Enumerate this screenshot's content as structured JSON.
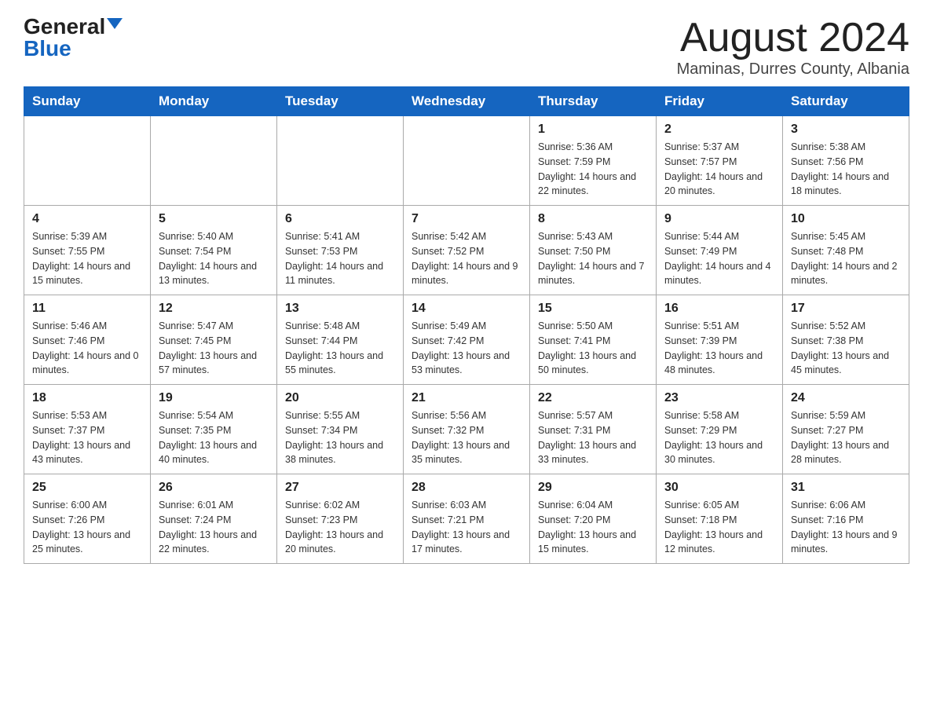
{
  "logo": {
    "text_general": "General",
    "text_blue": "Blue"
  },
  "title": "August 2024",
  "subtitle": "Maminas, Durres County, Albania",
  "days_of_week": [
    "Sunday",
    "Monday",
    "Tuesday",
    "Wednesday",
    "Thursday",
    "Friday",
    "Saturday"
  ],
  "weeks": [
    [
      null,
      null,
      null,
      null,
      {
        "num": "1",
        "sunrise": "Sunrise: 5:36 AM",
        "sunset": "Sunset: 7:59 PM",
        "daylight": "Daylight: 14 hours and 22 minutes."
      },
      {
        "num": "2",
        "sunrise": "Sunrise: 5:37 AM",
        "sunset": "Sunset: 7:57 PM",
        "daylight": "Daylight: 14 hours and 20 minutes."
      },
      {
        "num": "3",
        "sunrise": "Sunrise: 5:38 AM",
        "sunset": "Sunset: 7:56 PM",
        "daylight": "Daylight: 14 hours and 18 minutes."
      }
    ],
    [
      {
        "num": "4",
        "sunrise": "Sunrise: 5:39 AM",
        "sunset": "Sunset: 7:55 PM",
        "daylight": "Daylight: 14 hours and 15 minutes."
      },
      {
        "num": "5",
        "sunrise": "Sunrise: 5:40 AM",
        "sunset": "Sunset: 7:54 PM",
        "daylight": "Daylight: 14 hours and 13 minutes."
      },
      {
        "num": "6",
        "sunrise": "Sunrise: 5:41 AM",
        "sunset": "Sunset: 7:53 PM",
        "daylight": "Daylight: 14 hours and 11 minutes."
      },
      {
        "num": "7",
        "sunrise": "Sunrise: 5:42 AM",
        "sunset": "Sunset: 7:52 PM",
        "daylight": "Daylight: 14 hours and 9 minutes."
      },
      {
        "num": "8",
        "sunrise": "Sunrise: 5:43 AM",
        "sunset": "Sunset: 7:50 PM",
        "daylight": "Daylight: 14 hours and 7 minutes."
      },
      {
        "num": "9",
        "sunrise": "Sunrise: 5:44 AM",
        "sunset": "Sunset: 7:49 PM",
        "daylight": "Daylight: 14 hours and 4 minutes."
      },
      {
        "num": "10",
        "sunrise": "Sunrise: 5:45 AM",
        "sunset": "Sunset: 7:48 PM",
        "daylight": "Daylight: 14 hours and 2 minutes."
      }
    ],
    [
      {
        "num": "11",
        "sunrise": "Sunrise: 5:46 AM",
        "sunset": "Sunset: 7:46 PM",
        "daylight": "Daylight: 14 hours and 0 minutes."
      },
      {
        "num": "12",
        "sunrise": "Sunrise: 5:47 AM",
        "sunset": "Sunset: 7:45 PM",
        "daylight": "Daylight: 13 hours and 57 minutes."
      },
      {
        "num": "13",
        "sunrise": "Sunrise: 5:48 AM",
        "sunset": "Sunset: 7:44 PM",
        "daylight": "Daylight: 13 hours and 55 minutes."
      },
      {
        "num": "14",
        "sunrise": "Sunrise: 5:49 AM",
        "sunset": "Sunset: 7:42 PM",
        "daylight": "Daylight: 13 hours and 53 minutes."
      },
      {
        "num": "15",
        "sunrise": "Sunrise: 5:50 AM",
        "sunset": "Sunset: 7:41 PM",
        "daylight": "Daylight: 13 hours and 50 minutes."
      },
      {
        "num": "16",
        "sunrise": "Sunrise: 5:51 AM",
        "sunset": "Sunset: 7:39 PM",
        "daylight": "Daylight: 13 hours and 48 minutes."
      },
      {
        "num": "17",
        "sunrise": "Sunrise: 5:52 AM",
        "sunset": "Sunset: 7:38 PM",
        "daylight": "Daylight: 13 hours and 45 minutes."
      }
    ],
    [
      {
        "num": "18",
        "sunrise": "Sunrise: 5:53 AM",
        "sunset": "Sunset: 7:37 PM",
        "daylight": "Daylight: 13 hours and 43 minutes."
      },
      {
        "num": "19",
        "sunrise": "Sunrise: 5:54 AM",
        "sunset": "Sunset: 7:35 PM",
        "daylight": "Daylight: 13 hours and 40 minutes."
      },
      {
        "num": "20",
        "sunrise": "Sunrise: 5:55 AM",
        "sunset": "Sunset: 7:34 PM",
        "daylight": "Daylight: 13 hours and 38 minutes."
      },
      {
        "num": "21",
        "sunrise": "Sunrise: 5:56 AM",
        "sunset": "Sunset: 7:32 PM",
        "daylight": "Daylight: 13 hours and 35 minutes."
      },
      {
        "num": "22",
        "sunrise": "Sunrise: 5:57 AM",
        "sunset": "Sunset: 7:31 PM",
        "daylight": "Daylight: 13 hours and 33 minutes."
      },
      {
        "num": "23",
        "sunrise": "Sunrise: 5:58 AM",
        "sunset": "Sunset: 7:29 PM",
        "daylight": "Daylight: 13 hours and 30 minutes."
      },
      {
        "num": "24",
        "sunrise": "Sunrise: 5:59 AM",
        "sunset": "Sunset: 7:27 PM",
        "daylight": "Daylight: 13 hours and 28 minutes."
      }
    ],
    [
      {
        "num": "25",
        "sunrise": "Sunrise: 6:00 AM",
        "sunset": "Sunset: 7:26 PM",
        "daylight": "Daylight: 13 hours and 25 minutes."
      },
      {
        "num": "26",
        "sunrise": "Sunrise: 6:01 AM",
        "sunset": "Sunset: 7:24 PM",
        "daylight": "Daylight: 13 hours and 22 minutes."
      },
      {
        "num": "27",
        "sunrise": "Sunrise: 6:02 AM",
        "sunset": "Sunset: 7:23 PM",
        "daylight": "Daylight: 13 hours and 20 minutes."
      },
      {
        "num": "28",
        "sunrise": "Sunrise: 6:03 AM",
        "sunset": "Sunset: 7:21 PM",
        "daylight": "Daylight: 13 hours and 17 minutes."
      },
      {
        "num": "29",
        "sunrise": "Sunrise: 6:04 AM",
        "sunset": "Sunset: 7:20 PM",
        "daylight": "Daylight: 13 hours and 15 minutes."
      },
      {
        "num": "30",
        "sunrise": "Sunrise: 6:05 AM",
        "sunset": "Sunset: 7:18 PM",
        "daylight": "Daylight: 13 hours and 12 minutes."
      },
      {
        "num": "31",
        "sunrise": "Sunrise: 6:06 AM",
        "sunset": "Sunset: 7:16 PM",
        "daylight": "Daylight: 13 hours and 9 minutes."
      }
    ]
  ]
}
